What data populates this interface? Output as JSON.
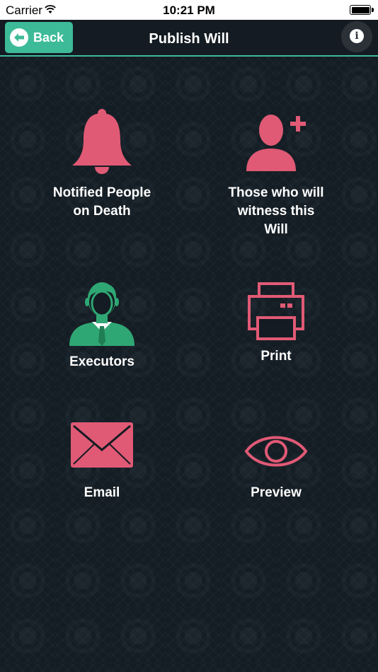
{
  "status_bar": {
    "carrier": "Carrier",
    "time": "10:21 PM"
  },
  "nav": {
    "back_label": "Back",
    "title": "Publish Will"
  },
  "tiles": [
    {
      "label": "Notified People\non Death",
      "icon": "bell-icon"
    },
    {
      "label": "Those who will\nwitness this\nWill",
      "icon": "add-person-icon"
    },
    {
      "label": "Executors",
      "icon": "businessman-icon"
    },
    {
      "label": "Print",
      "icon": "printer-icon"
    },
    {
      "label": "Email",
      "icon": "envelope-icon"
    },
    {
      "label": "Preview",
      "icon": "eye-icon"
    }
  ],
  "colors": {
    "accent": "#3dbb98",
    "icon_pink": "#e05a75",
    "background": "#141b22"
  }
}
